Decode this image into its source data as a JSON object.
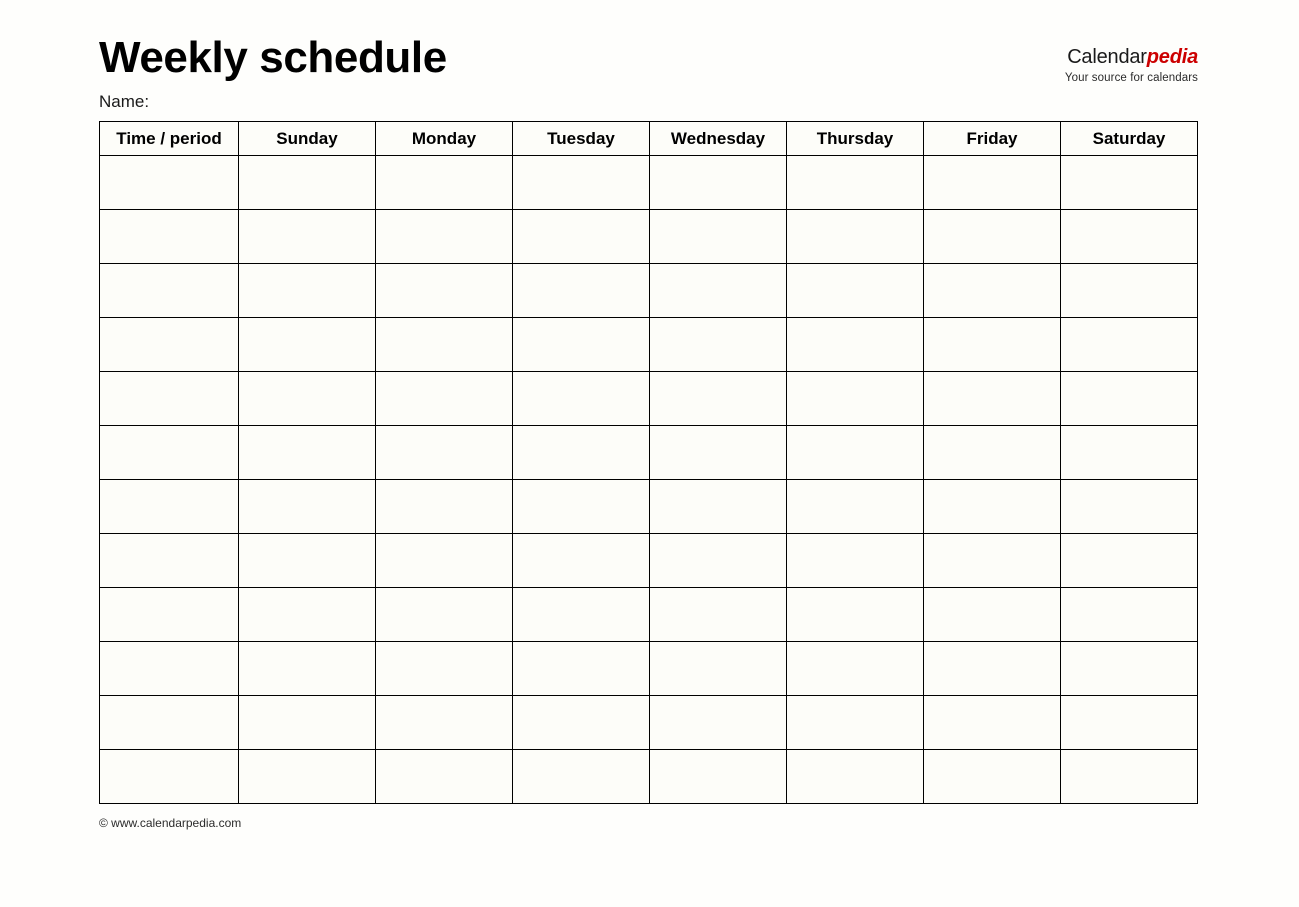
{
  "document": {
    "title": "Weekly schedule",
    "name_label": "Name:",
    "name_value": ""
  },
  "logo": {
    "part_one": "Calendar",
    "part_two": "pedia",
    "tagline": "Your source for calendars",
    "color_primary": "#1a1a1a",
    "color_accent": "#cc0000"
  },
  "table": {
    "headers": [
      "Time / period",
      "Sunday",
      "Monday",
      "Tuesday",
      "Wednesday",
      "Thursday",
      "Friday",
      "Saturday"
    ],
    "row_count": 12,
    "column_count": 8,
    "rows": [
      [
        "",
        "",
        "",
        "",
        "",
        "",
        "",
        ""
      ],
      [
        "",
        "",
        "",
        "",
        "",
        "",
        "",
        ""
      ],
      [
        "",
        "",
        "",
        "",
        "",
        "",
        "",
        ""
      ],
      [
        "",
        "",
        "",
        "",
        "",
        "",
        "",
        ""
      ],
      [
        "",
        "",
        "",
        "",
        "",
        "",
        "",
        ""
      ],
      [
        "",
        "",
        "",
        "",
        "",
        "",
        "",
        ""
      ],
      [
        "",
        "",
        "",
        "",
        "",
        "",
        "",
        ""
      ],
      [
        "",
        "",
        "",
        "",
        "",
        "",
        "",
        ""
      ],
      [
        "",
        "",
        "",
        "",
        "",
        "",
        "",
        ""
      ],
      [
        "",
        "",
        "",
        "",
        "",
        "",
        "",
        ""
      ],
      [
        "",
        "",
        "",
        "",
        "",
        "",
        "",
        ""
      ],
      [
        "",
        "",
        "",
        "",
        "",
        "",
        "",
        ""
      ]
    ]
  },
  "footer": {
    "copyright": "© www.calendarpedia.com"
  }
}
